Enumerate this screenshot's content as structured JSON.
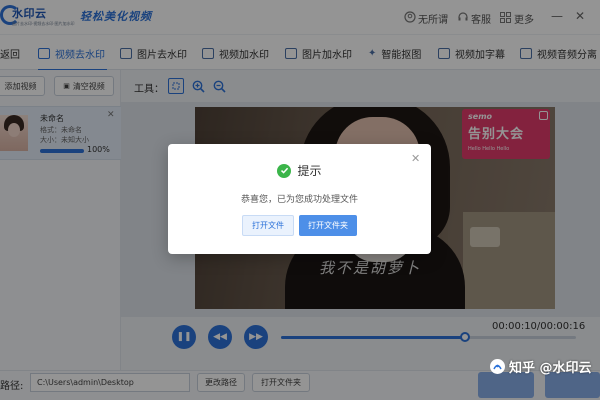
{
  "app": {
    "logo_text": "水印云",
    "logo_subtitle": "图片去水印·视频去水印·图片加水印",
    "slogan": "轻松美化视频"
  },
  "header": {
    "items": [
      {
        "icon": "user-circle-icon",
        "label": "无所谓"
      },
      {
        "icon": "headset-icon",
        "label": "客服"
      },
      {
        "icon": "grid-icon",
        "label": "更多"
      }
    ],
    "window_controls": [
      "minimize",
      "close"
    ]
  },
  "tabs": [
    {
      "label": "返回",
      "active": false
    },
    {
      "label": "视频去水印",
      "active": true
    },
    {
      "label": "图片去水印",
      "active": false
    },
    {
      "label": "视频加水印",
      "active": false
    },
    {
      "label": "图片加水印",
      "active": false
    },
    {
      "label": "智能抠图",
      "active": false
    },
    {
      "label": "视频加字幕",
      "active": false
    },
    {
      "label": "视频音频分离",
      "active": false
    }
  ],
  "left_panel": {
    "add_button": "添加视频",
    "clear_button": "清空视频",
    "file": {
      "name": "未命名",
      "format_label": "格式：",
      "format_value": "未命名",
      "size_label": "大小：",
      "size_value": "未知大小",
      "progress_text": "100%",
      "progress": 1.0
    }
  },
  "toolbar": {
    "label": "工具：",
    "tools": [
      "select-frame-icon",
      "zoom-in-icon",
      "zoom-out-icon"
    ]
  },
  "video": {
    "sticker_line1": "semo",
    "sticker_line2": "告别大会",
    "sticker_line3": "Hello Hello Hello",
    "caption": "我不是胡萝卜"
  },
  "player": {
    "time": "00:00:10/00:00:16",
    "progress": 0.625,
    "controls": [
      "pause-icon",
      "rewind-icon",
      "fast-forward-icon"
    ]
  },
  "bottom": {
    "path_label": "路径:",
    "path_value": "C:\\Users\\admin\\Desktop",
    "change_path": "更改路径",
    "open_folder": "打开文件夹"
  },
  "watermark": {
    "text": "知乎 @水印云"
  },
  "dialog": {
    "title": "提示",
    "message": "恭喜您，已为您成功处理文件",
    "button_open_file": "打开文件",
    "button_open_folder": "打开文件夹"
  },
  "colors": {
    "accent": "#2d73d9",
    "success": "#3bb54a",
    "sticker": "#e23b6b"
  }
}
